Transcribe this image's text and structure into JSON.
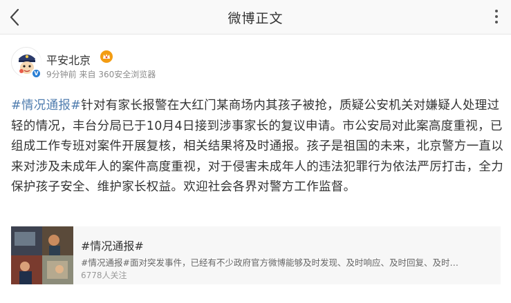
{
  "navbar": {
    "title": "微博正文",
    "back_icon": "chevron-left-icon",
    "more_icon": "more-vertical-icon"
  },
  "author": {
    "name": "平安北京",
    "time": "9分钟前",
    "source_prefix": "来自",
    "source": "360安全浏览器",
    "verified_color": "#2a7fd4"
  },
  "post": {
    "hashtag": "#情况通报#",
    "text": "针对有家长报警在大红门某商场内其孩子被抢，质疑公安机关对嫌疑人处理过轻的情况，丰台分局已于10月4日接到涉事家长的复议申请。市公安局对此案高度重视，已组成工作专班对案件开展复核，相关结果将及时通报。孩子是祖国的未来，北京警方一直以来对涉及未成年人的案件高度重视，对于侵害未成年人的违法犯罪行为依法严厉打击，全力保护孩子安全、维护家长权益。欢迎社会各界对警方工作监督。"
  },
  "topic_card": {
    "title": "#情况通报#",
    "description": "#情况通报#面对突发事件，已经有不少政府官方微博能够及时发现、及时响应、及时回复、及时…",
    "followers": "6778人关注"
  },
  "colors": {
    "link": "#507daf",
    "meta_gray": "#8c8c8c",
    "card_bg": "#f7f7f7"
  }
}
